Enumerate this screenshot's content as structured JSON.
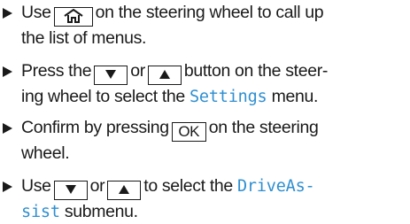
{
  "steps": [
    {
      "p1": "Use",
      "p2": "on the steering wheel to call up",
      "line2": "the list of menus.",
      "key_icon": "home-icon"
    },
    {
      "p1": "Press the",
      "p2": "or",
      "p3": "button on the steer-",
      "line2_a": "ing wheel to select the",
      "line2_term": "Settings",
      "line2_b": "menu.",
      "key1_icon": "arrow-down-icon",
      "key2_icon": "arrow-up-icon"
    },
    {
      "p1": "Confirm by pressing",
      "key_label": "OK",
      "p2": "on the steering",
      "line2": "wheel."
    },
    {
      "p1": "Use",
      "p2": "or",
      "p3": "to select the",
      "term_a": "DriveAs-",
      "term_b": "sist",
      "line2_b": "submenu.",
      "key1_icon": "arrow-down-icon",
      "key2_icon": "arrow-up-icon"
    }
  ],
  "colors": {
    "menu_term": "#2f8fd0",
    "text": "#1a1a1a"
  }
}
